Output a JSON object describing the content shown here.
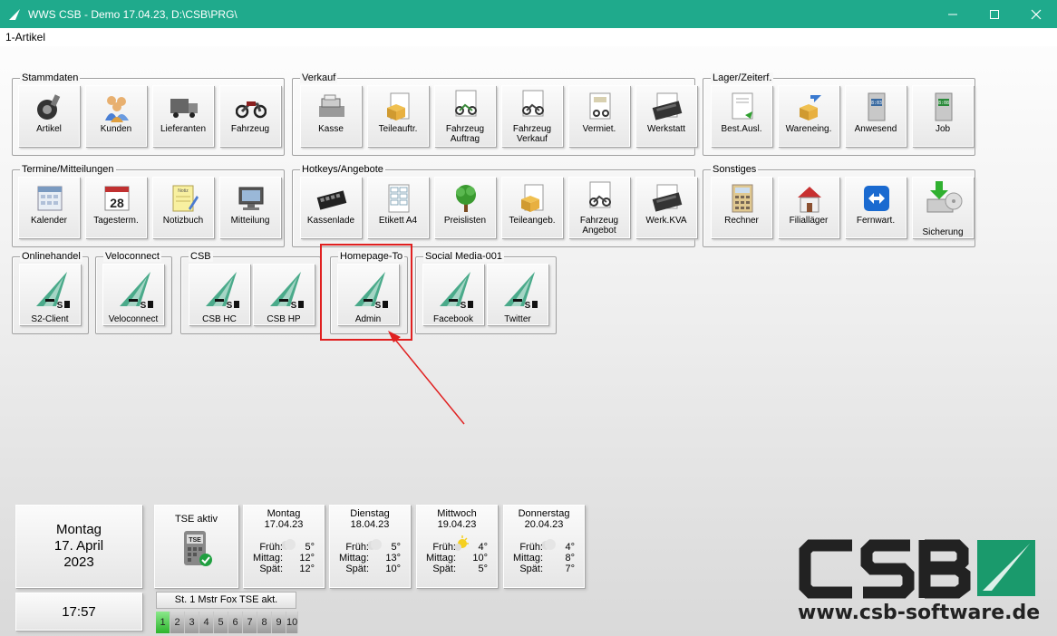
{
  "window": {
    "title": "WWS CSB - Demo  17.04.23, D:\\CSB\\PRG\\"
  },
  "menu": {
    "items": [
      {
        "label": "1-Artikel"
      }
    ]
  },
  "groups": {
    "stammdaten": {
      "title": "Stammdaten",
      "tiles": [
        "Artikel",
        "Kunden",
        "Lieferanten",
        "Fahrzeug"
      ]
    },
    "verkauf": {
      "title": "Verkauf",
      "tiles": [
        "Kasse",
        "Teileauftr.",
        "Fahrzeug Auftrag",
        "Fahrzeug Verkauf",
        "Vermiet.",
        "Werkstatt"
      ]
    },
    "lager": {
      "title": "Lager/Zeiterf.",
      "tiles": [
        "Best.Ausl.",
        "Wareneing.",
        "Anwesend",
        "Job"
      ]
    },
    "termine": {
      "title": "Termine/Mitteilungen",
      "tiles": [
        "Kalender",
        "Tagesterm.",
        "Notizbuch",
        "Mitteilung"
      ]
    },
    "hotkeys": {
      "title": "Hotkeys/Angebote",
      "tiles": [
        "Kassenlade",
        "Etikett A4",
        "Preislisten",
        "Teileangeb.",
        "Fahrzeug Angebot",
        "Werk.KVA"
      ]
    },
    "sonstiges": {
      "title": "Sonstiges",
      "tiles": [
        "Rechner",
        "Filialläger",
        "Fernwart.",
        "Sicherung"
      ]
    },
    "onlinehandel": {
      "title": "Onlinehandel",
      "tiles": [
        "S2-Client"
      ]
    },
    "veloconnect": {
      "title": "Veloconnect",
      "tiles": [
        "Veloconnect"
      ]
    },
    "csb": {
      "title": "CSB",
      "tiles": [
        "CSB HC",
        "CSB HP"
      ]
    },
    "homepage": {
      "title": "Homepage-To",
      "tiles": [
        "Admin"
      ]
    },
    "social": {
      "title": "Social Media-001",
      "tiles": [
        "Facebook",
        "Twitter"
      ]
    }
  },
  "calendar": {
    "weekday": "Montag",
    "date": "17. April",
    "year": "2023",
    "time": "17:57"
  },
  "tse": {
    "label": "TSE aktiv",
    "icon": "tse-device-icon",
    "station": "St. 1 Mstr Fox TSE akt."
  },
  "stations": [
    "1",
    "2",
    "3",
    "4",
    "5",
    "6",
    "7",
    "8",
    "9",
    "10"
  ],
  "weather": [
    {
      "day": "Montag",
      "date": "17.04.23",
      "frueh": "5°",
      "mittag": "12°",
      "spaet": "12°",
      "icon": "cloud-icon"
    },
    {
      "day": "Dienstag",
      "date": "18.04.23",
      "frueh": "5°",
      "mittag": "13°",
      "spaet": "10°",
      "icon": "cloud-icon"
    },
    {
      "day": "Mittwoch",
      "date": "19.04.23",
      "frueh": "4°",
      "mittag": "10°",
      "spaet": "5°",
      "icon": "sun-cloud-icon"
    },
    {
      "day": "Donnerstag",
      "date": "20.04.23",
      "frueh": "4°",
      "mittag": "8°",
      "spaet": "7°",
      "icon": "cloud-icon"
    }
  ],
  "weather_labels": {
    "frueh": "Früh:",
    "mittag": "Mittag:",
    "spaet": "Spät:"
  },
  "logo": {
    "text": "CSB",
    "url": "www.csb-software.de"
  },
  "colors": {
    "titlebar": "#1faa8c",
    "highlight": "#e02020",
    "logo_green": "#1a9a6c",
    "logo_dark": "#222222"
  }
}
